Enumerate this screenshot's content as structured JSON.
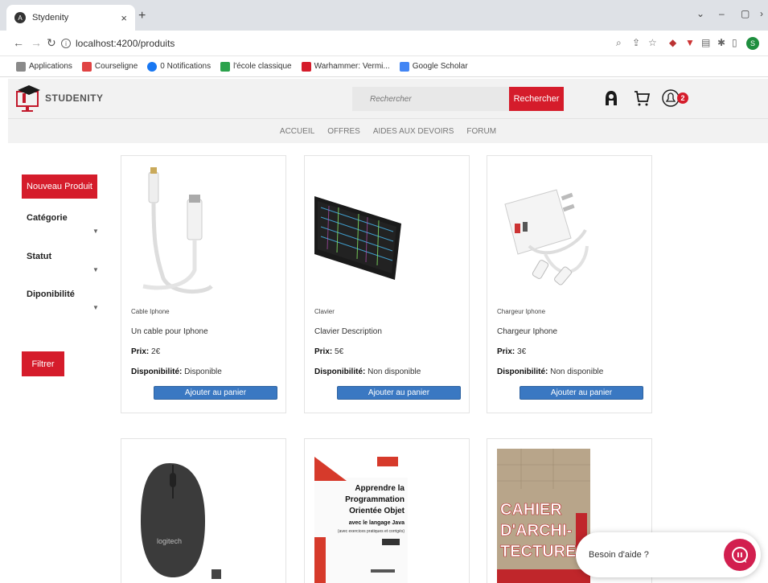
{
  "browser": {
    "tab_title": "Stydenity",
    "url": "localhost:4200/produits",
    "profile_initial": "S",
    "bookmarks": [
      {
        "label": "Applications",
        "color": "#8a8a8a"
      },
      {
        "label": "Courseligne",
        "color": "#e04343"
      },
      {
        "label": "0 Notifications",
        "color": "#1877f2"
      },
      {
        "label": "l'école classique",
        "color": "#2ba24c"
      },
      {
        "label": "Warhammer: Vermi...",
        "color": "#d51c2b"
      },
      {
        "label": "Google Scholar",
        "color": "#4285f4"
      }
    ]
  },
  "header": {
    "brand": "STUDENITY",
    "search_placeholder": "Rechercher",
    "search_button": "Rechercher",
    "notification_count": "2"
  },
  "menu": [
    "ACCUEIL",
    "OFFRES",
    "AIDES AUX DEVOIRS",
    "FORUM"
  ],
  "sidebar": {
    "new_button": "Nouveau Produit",
    "filters": [
      "Catégorie",
      "Statut",
      "Diponibilité"
    ],
    "filter_button": "Filtrer"
  },
  "labels": {
    "price": "Prix:",
    "availability": "Disponibilité:",
    "add_to_cart": "Ajouter au panier"
  },
  "products": [
    {
      "category": "Cable Iphone",
      "description": "Un cable pour Iphone",
      "price": "2€",
      "availability": "Disponible"
    },
    {
      "category": "Clavier",
      "description": "Clavier Description",
      "price": "5€",
      "availability": "Non disponible"
    },
    {
      "category": "Chargeur Iphone",
      "description": "Chargeur Iphone",
      "price": "3€",
      "availability": "Non disponible"
    }
  ],
  "product_images_row2": {
    "mouse_brand": "logitech",
    "book_title": [
      "Apprendre la",
      "Programmation",
      "Orientée Objet",
      "avec le langage Java"
    ],
    "book_subtitle": "(avec exercices pratiques et corrigés)",
    "cahier_title": [
      "CAHIER",
      "D'ARCHI-",
      "TECTURE"
    ]
  },
  "chat": {
    "label": "Besoin d'aide ?"
  }
}
